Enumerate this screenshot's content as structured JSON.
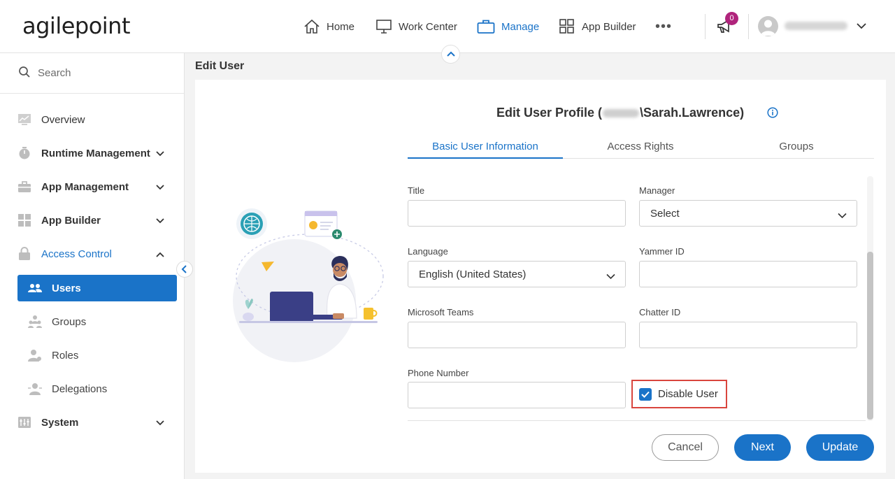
{
  "brand": {
    "logo_text": "agilepoint"
  },
  "topnav": {
    "items": [
      {
        "label": "Home",
        "icon": "home-icon"
      },
      {
        "label": "Work Center",
        "icon": "monitor-icon"
      },
      {
        "label": "Manage",
        "icon": "briefcase-icon",
        "active": true
      },
      {
        "label": "App Builder",
        "icon": "grid-icon"
      }
    ],
    "more": "•••",
    "notification_count": "0"
  },
  "sidebar": {
    "search_placeholder": "Search",
    "items": [
      {
        "label": "Overview"
      },
      {
        "label": "Runtime Management"
      },
      {
        "label": "App Management"
      },
      {
        "label": "App Builder"
      },
      {
        "label": "Access Control"
      },
      {
        "label": "System"
      }
    ],
    "sub_items": [
      {
        "label": "Users"
      },
      {
        "label": "Groups"
      },
      {
        "label": "Roles"
      },
      {
        "label": "Delegations"
      }
    ]
  },
  "page": {
    "title": "Edit User",
    "profile_prefix": "Edit User Profile (",
    "profile_suffix": "\\Sarah.Lawrence)"
  },
  "tabs": [
    {
      "label": "Basic User Information",
      "active": true
    },
    {
      "label": "Access Rights"
    },
    {
      "label": "Groups"
    }
  ],
  "form": {
    "title_label": "Title",
    "title_value": "",
    "manager_label": "Manager",
    "manager_value": "Select",
    "language_label": "Language",
    "language_value": "English (United States)",
    "yammer_label": "Yammer ID",
    "yammer_value": "",
    "teams_label": "Microsoft Teams",
    "teams_value": "",
    "chatter_label": "Chatter ID",
    "chatter_value": "",
    "phone_label": "Phone Number",
    "phone_value": "",
    "disable_label": "Disable User",
    "disable_checked": true
  },
  "buttons": {
    "cancel": "Cancel",
    "next": "Next",
    "update": "Update"
  },
  "colors": {
    "accent": "#1a73c8",
    "badge": "#b0247c",
    "highlight": "#d9453d"
  }
}
